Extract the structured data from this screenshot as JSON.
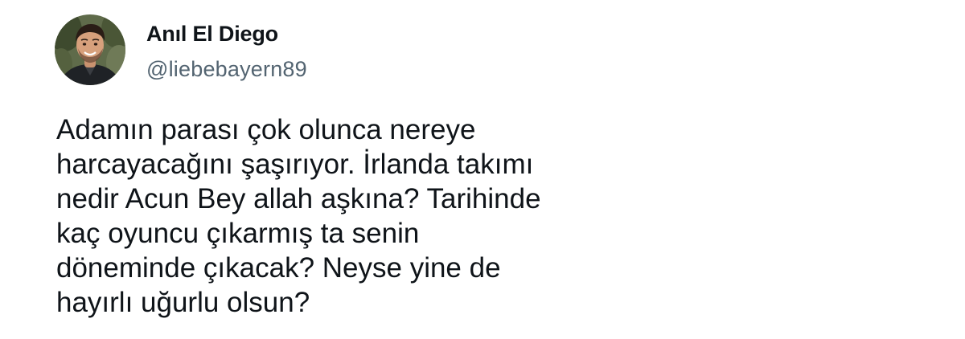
{
  "author": {
    "display_name": "Anıl El Diego",
    "handle": "@liebebayern89",
    "avatar_icon": "profile-photo"
  },
  "tweet": {
    "lines": [
      "Adamın parası çok olunca nereye",
      "harcayacağını şaşırıyor. İrlanda takımı",
      "nedir Acun Bey allah aşkına? Tarihinde",
      "kaç oyuncu çıkarmış ta senin",
      "döneminde çıkacak? Neyse yine de",
      "hayırlı uğurlu olsun?"
    ]
  },
  "colors": {
    "text_primary": "#0f1419",
    "text_secondary": "#536471",
    "background": "#ffffff"
  }
}
